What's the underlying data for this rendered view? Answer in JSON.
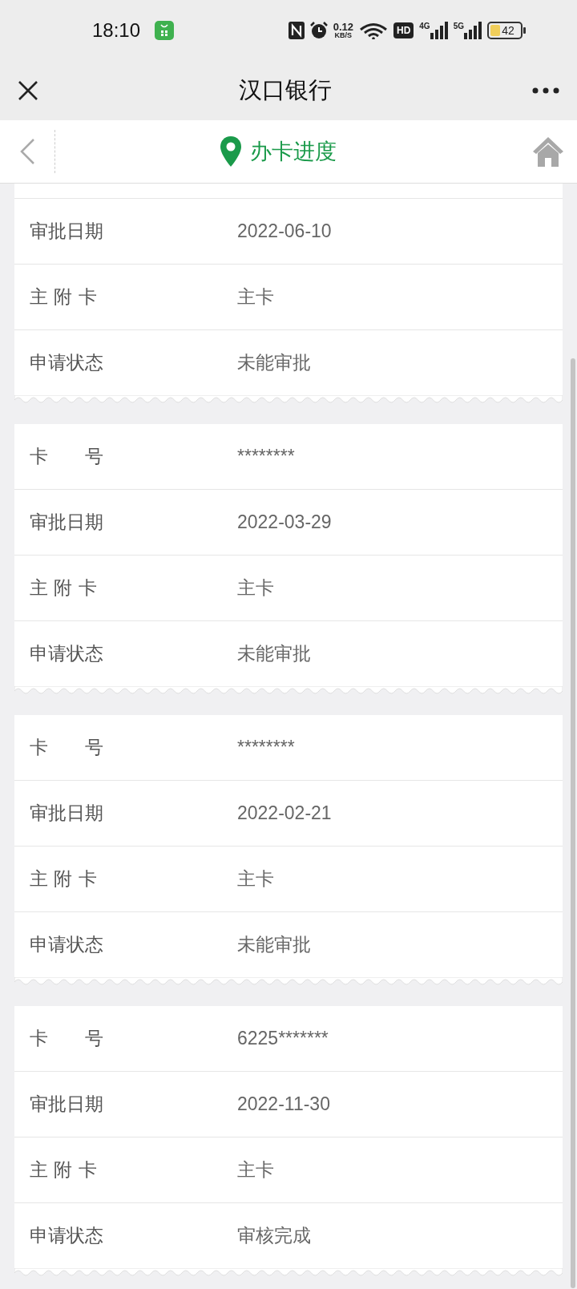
{
  "status_bar": {
    "time": "18:10",
    "net_speed": "0.12",
    "net_unit": "KB/S",
    "hd": "HD",
    "signal_1": "4G",
    "signal_2": "5G",
    "battery": "42"
  },
  "header": {
    "title": "汉口银行"
  },
  "nav": {
    "title": "办卡进度"
  },
  "cards": [
    {
      "cut_top": true,
      "rows": [
        {
          "label": "审批日期",
          "value": "2022-06-10"
        },
        {
          "label": "主 附 卡",
          "value": "主卡"
        },
        {
          "label": "申请状态",
          "value": "未能审批"
        }
      ]
    },
    {
      "cut_top": false,
      "rows": [
        {
          "label": "卡　　号",
          "value": "********"
        },
        {
          "label": "审批日期",
          "value": "2022-03-29"
        },
        {
          "label": "主 附 卡",
          "value": "主卡"
        },
        {
          "label": "申请状态",
          "value": "未能审批"
        }
      ]
    },
    {
      "cut_top": false,
      "rows": [
        {
          "label": "卡　　号",
          "value": "********"
        },
        {
          "label": "审批日期",
          "value": "2022-02-21"
        },
        {
          "label": "主 附 卡",
          "value": "主卡"
        },
        {
          "label": "申请状态",
          "value": "未能审批"
        }
      ]
    },
    {
      "cut_top": false,
      "rows": [
        {
          "label": "卡　　号",
          "value": "6225*******"
        },
        {
          "label": "审批日期",
          "value": "2022-11-30"
        },
        {
          "label": "主 附 卡",
          "value": "主卡"
        },
        {
          "label": "申请状态",
          "value": "审核完成"
        }
      ]
    }
  ]
}
